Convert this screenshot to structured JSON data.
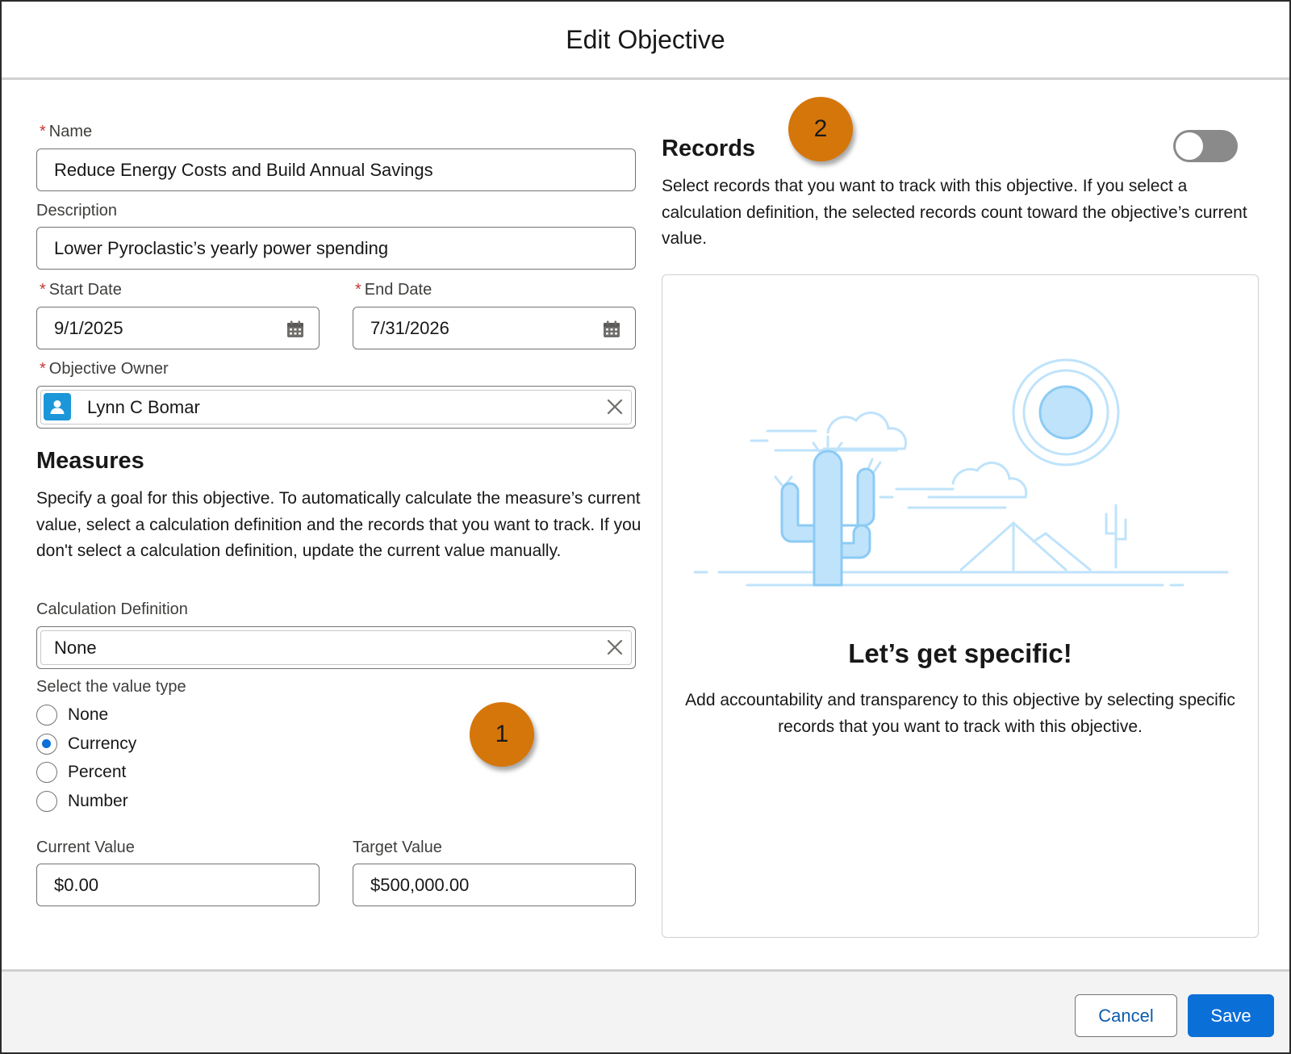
{
  "header": {
    "title": "Edit Objective"
  },
  "form": {
    "name": {
      "label": "Name",
      "value": "Reduce Energy Costs and Build Annual Savings"
    },
    "description": {
      "label": "Description",
      "value": "Lower Pyroclastic’s yearly power spending"
    },
    "start_date": {
      "label": "Start Date",
      "value": "9/1/2025"
    },
    "end_date": {
      "label": "End Date",
      "value": "7/31/2026"
    },
    "owner": {
      "label": "Objective Owner",
      "value": "Lynn C Bomar"
    },
    "required_marker": "*"
  },
  "measures": {
    "title": "Measures",
    "description": "Specify a goal for this objective. To automatically calculate the measure’s current value, select a calculation definition and the records that you want to track. If you don't select a calculation definition, update the current value manually.",
    "calc_definition": {
      "label": "Calculation Definition",
      "value": "None"
    },
    "value_type": {
      "label": "Select the value type",
      "options": [
        {
          "label": "None",
          "checked": false
        },
        {
          "label": "Currency",
          "checked": true
        },
        {
          "label": "Percent",
          "checked": false
        },
        {
          "label": "Number",
          "checked": false
        }
      ]
    },
    "current_value": {
      "label": "Current Value",
      "value": "$0.00"
    },
    "target_value": {
      "label": "Target Value",
      "value": "$500,000.00"
    }
  },
  "records": {
    "title": "Records",
    "toggle_on": false,
    "description": "Select records that you want to track with this objective. If you select a calculation definition, the selected records count toward the objective’s current value.",
    "empty_state": {
      "title": "Let’s get specific!",
      "text": "Add accountability and transparency to this objective by selecting specific records that you want to track with this objective."
    }
  },
  "callouts": {
    "one": "1",
    "two": "2",
    "color": "#d5760b"
  },
  "footer": {
    "cancel_label": "Cancel",
    "save_label": "Save"
  },
  "colors": {
    "brand": "#0b6fd8",
    "illustration": "#bfe3fb"
  }
}
